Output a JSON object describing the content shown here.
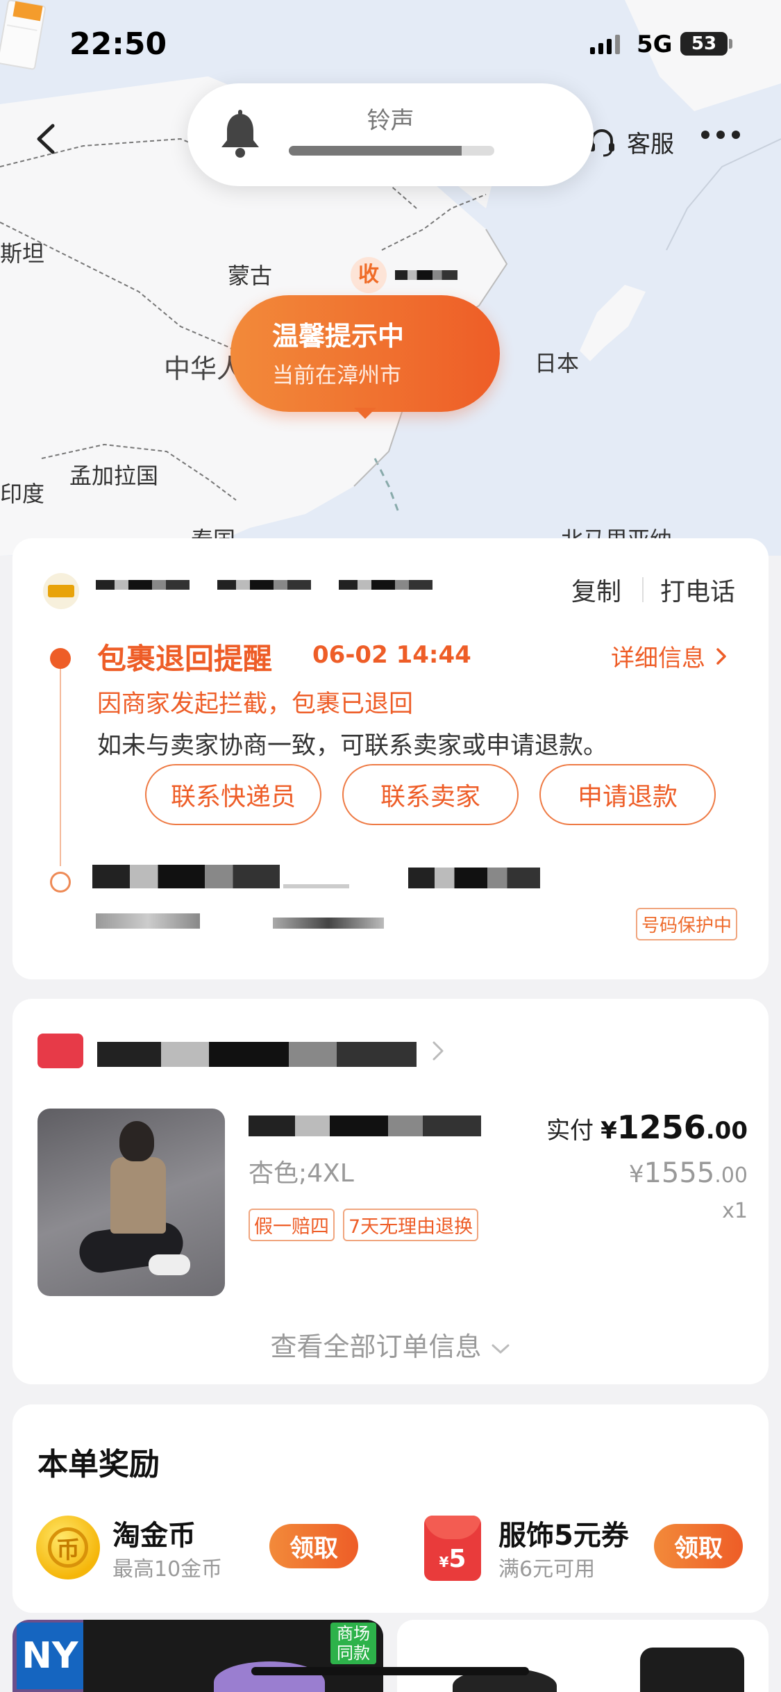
{
  "status_bar": {
    "time": "22:50",
    "network": "5G",
    "battery": "53"
  },
  "nav": {
    "service_label": "客服"
  },
  "volume_hud": {
    "title": "铃声",
    "level": 0.84
  },
  "map": {
    "labels": [
      "斯坦",
      "蒙古",
      "中华人",
      "日本",
      "孟加拉国",
      "印度",
      "泰国",
      "北马里亚纳",
      "里"
    ]
  },
  "receiver_marker": {
    "label": "收"
  },
  "bubble": {
    "title": "温馨提示中",
    "subtitle": "当前在漳州市"
  },
  "logistics": {
    "copy_label": "复制",
    "call_label": "打电话",
    "event": {
      "title": "包裹退回提醒",
      "time": "06-02 14:44",
      "detail_label": "详细信息",
      "line1": "因商家发起拦截，包裹已退回",
      "line2": "如未与卖家协商一致，可联系卖家或申请退款。"
    },
    "buttons": [
      "联系快递员",
      "联系卖家",
      "申请退款"
    ],
    "privacy_badge": "号码保护中"
  },
  "order": {
    "sku": "杏色;4XL",
    "tags": [
      "假一赔四",
      "7天无理由退换"
    ],
    "paid_label": "实付",
    "currency": "¥",
    "paid_int": "1256",
    "paid_dec": ".00",
    "orig_int": "1555",
    "orig_dec": ".00",
    "qty": "x1",
    "view_all": "查看全部订单信息"
  },
  "reward": {
    "title": "本单奖励",
    "items": [
      {
        "name": "淘金币",
        "sub": "最高10金币",
        "button": "领取",
        "icon_glyph": "币"
      },
      {
        "name": "服饰5元券",
        "sub": "满6元可用",
        "button": "领取",
        "icon_value": "5"
      }
    ]
  },
  "products": {
    "badge": "商场\n同款",
    "brand_glyph": "NY"
  },
  "colors": {
    "accent": "#ee5d27",
    "accent_light": "#f28a3a",
    "map_bg": "#e6ecf5"
  }
}
